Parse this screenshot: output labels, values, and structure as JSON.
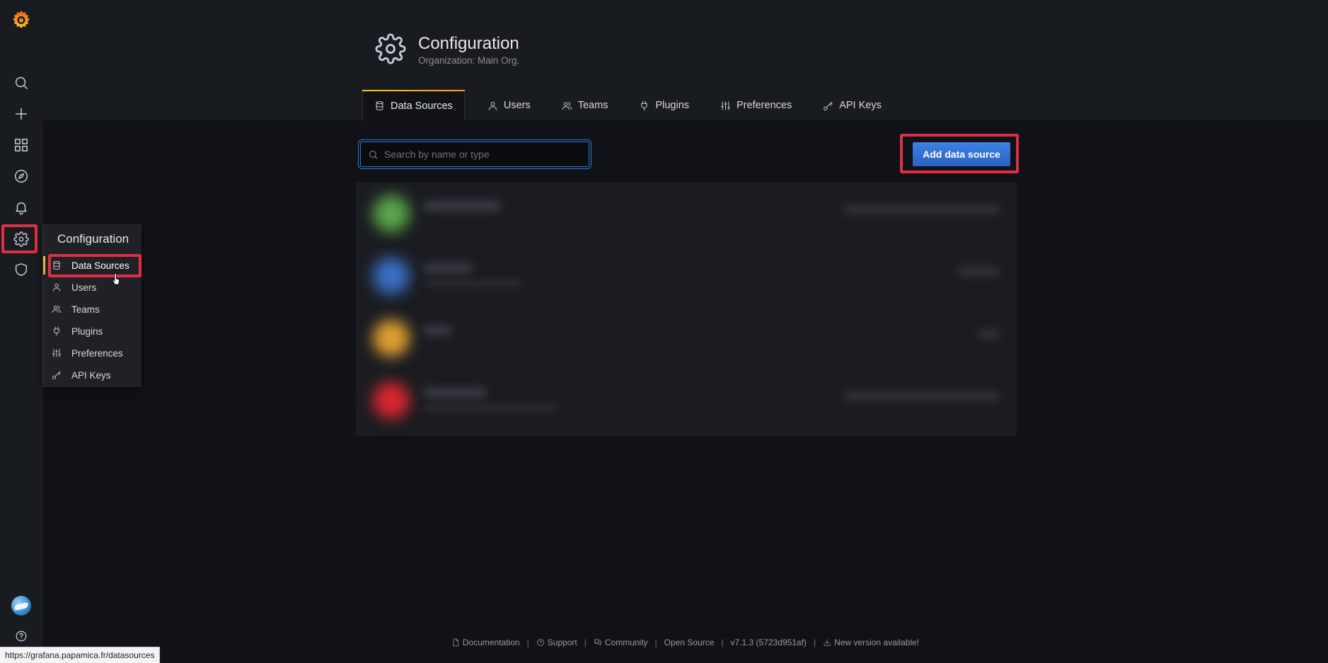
{
  "header": {
    "title": "Configuration",
    "subtitle": "Organization: Main Org."
  },
  "tabs": [
    {
      "label": "Data Sources",
      "icon": "database-icon",
      "active": true
    },
    {
      "label": "Users",
      "icon": "user-icon",
      "active": false
    },
    {
      "label": "Teams",
      "icon": "users-icon",
      "active": false
    },
    {
      "label": "Plugins",
      "icon": "plug-icon",
      "active": false
    },
    {
      "label": "Preferences",
      "icon": "sliders-icon",
      "active": false
    },
    {
      "label": "API Keys",
      "icon": "key-icon",
      "active": false
    }
  ],
  "search": {
    "placeholder": "Search by name or type",
    "value": ""
  },
  "actions": {
    "add_label": "Add data source"
  },
  "sidebar": {
    "items": [
      "grafana-logo",
      "search-icon",
      "plus-icon",
      "dashboards-icon",
      "compass-icon",
      "bell-icon",
      "gear-icon",
      "shield-icon",
      "avatar",
      "help-icon"
    ]
  },
  "flyout": {
    "title": "Configuration",
    "items": [
      {
        "label": "Data Sources",
        "icon": "database-icon",
        "active": true
      },
      {
        "label": "Users",
        "icon": "user-icon"
      },
      {
        "label": "Teams",
        "icon": "users-icon"
      },
      {
        "label": "Plugins",
        "icon": "plug-icon"
      },
      {
        "label": "Preferences",
        "icon": "sliders-icon"
      },
      {
        "label": "API Keys",
        "icon": "key-icon"
      }
    ]
  },
  "datasources_colors": [
    "#5aa64b",
    "#3a6fc4",
    "#e0a030",
    "#d8272e"
  ],
  "footer": {
    "documentation": "Documentation",
    "support": "Support",
    "community": "Community",
    "open_source": "Open Source",
    "version": "v7.1.3 (5723d951af)",
    "new_version": "New version available!"
  },
  "status_url": "https://grafana.papamica.fr/datasources",
  "colors": {
    "accent": "#3274d9",
    "highlight": "#e02f44",
    "active_gradient_start": "#f2cc0c",
    "active_gradient_end": "#ff9830"
  }
}
